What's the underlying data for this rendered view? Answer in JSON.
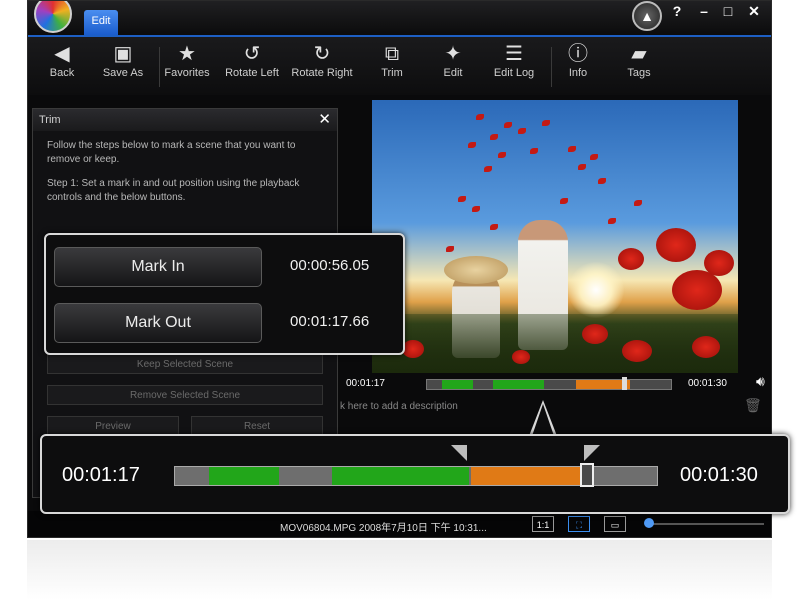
{
  "titlebar": {
    "tab_label": "Edit",
    "help_label": "?",
    "minimize_label": "–",
    "maximize_label": "□",
    "close_label": "✕"
  },
  "toolbar": {
    "items": [
      {
        "label": "Back",
        "icon": "back-arrow-icon"
      },
      {
        "label": "Save As",
        "icon": "save-as-icon"
      },
      {
        "label": "Favorites",
        "icon": "star-icon"
      },
      {
        "label": "Rotate Left",
        "icon": "rotate-left-icon"
      },
      {
        "label": "Rotate Right",
        "icon": "rotate-right-icon"
      },
      {
        "label": "Trim",
        "icon": "trim-icon"
      },
      {
        "label": "Edit",
        "icon": "magic-wand-icon"
      },
      {
        "label": "Edit Log",
        "icon": "list-icon"
      },
      {
        "label": "Info",
        "icon": "info-icon"
      },
      {
        "label": "Tags",
        "icon": "tag-icon"
      }
    ]
  },
  "trim_panel": {
    "title": "Trim",
    "instructions": "Follow the steps below to mark a scene that you want to remove or keep.",
    "step1": "Step 1: Set a mark in and out position using the playback controls and the below buttons.",
    "keep_label": "Keep Selected Scene",
    "remove_label": "Remove Selected Scene",
    "preview_label": "Preview",
    "reset_label": "Reset"
  },
  "mark_in": {
    "label": "Mark In",
    "time": "00:00:56.05"
  },
  "mark_out": {
    "label": "Mark Out",
    "time": "00:01:17.66"
  },
  "transport": {
    "current_time": "00:01:17",
    "total_time": "00:01:30",
    "description_placeholder": "k here to add a description"
  },
  "zoomed_timeline": {
    "current_time": "00:01:17",
    "total_time": "00:01:30",
    "segments": [
      {
        "color": "#6e6e6e",
        "start": 0.0,
        "end": 0.07
      },
      {
        "color": "#22a61a",
        "start": 0.07,
        "end": 0.215
      },
      {
        "color": "#6e6e6e",
        "start": 0.215,
        "end": 0.325
      },
      {
        "color": "#22a61a",
        "start": 0.325,
        "end": 0.61
      },
      {
        "color": "#6e6e6e",
        "start": 0.61,
        "end": 0.615
      },
      {
        "color": "#e07a16",
        "start": 0.615,
        "end": 0.845
      },
      {
        "color": "#6e6e6e",
        "start": 0.845,
        "end": 1.0
      }
    ],
    "mark_in_fraction": 0.59,
    "mark_out_fraction": 0.865,
    "playhead_fraction": 0.855
  },
  "statusbar": {
    "file_info": "MOV06804.MPG  2008年7月10日 下午 10:31...",
    "zoom_1to1_label": "1:1"
  },
  "colors": {
    "accent_blue": "#1d5fc4",
    "green_segment": "#22a61a",
    "orange_segment": "#e07a16"
  }
}
